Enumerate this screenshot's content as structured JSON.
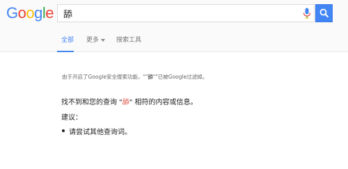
{
  "header": {
    "logo": {
      "letters": [
        "G",
        "o",
        "o",
        "g",
        "l",
        "e"
      ],
      "colors": [
        "#4285f4",
        "#ea4335",
        "#fbbc05",
        "#4285f4",
        "#34a853",
        "#ea4335"
      ]
    },
    "search": {
      "value": "舔",
      "mic_icon": "microphone-icon",
      "search_icon": "magnifier-icon",
      "button_color": "#4285f4"
    }
  },
  "tabs": {
    "all": "全部",
    "more": "更多",
    "tools": "搜索工具",
    "active_color": "#4285f4"
  },
  "notice": {
    "prefix": "由于开启了Google安全搜索功能，\"\"",
    "filtered_term": "舔",
    "suffix": "\"\"已被Google过滤掉。"
  },
  "results": {
    "no_results_prefix": "找不到和您的查询 \"",
    "query": "舔",
    "no_results_suffix": "\" 相符的内容或信息。",
    "suggestions_label": "建议：",
    "suggestions": [
      "请尝试其他查询词。"
    ],
    "query_color": "#dd4b39"
  }
}
